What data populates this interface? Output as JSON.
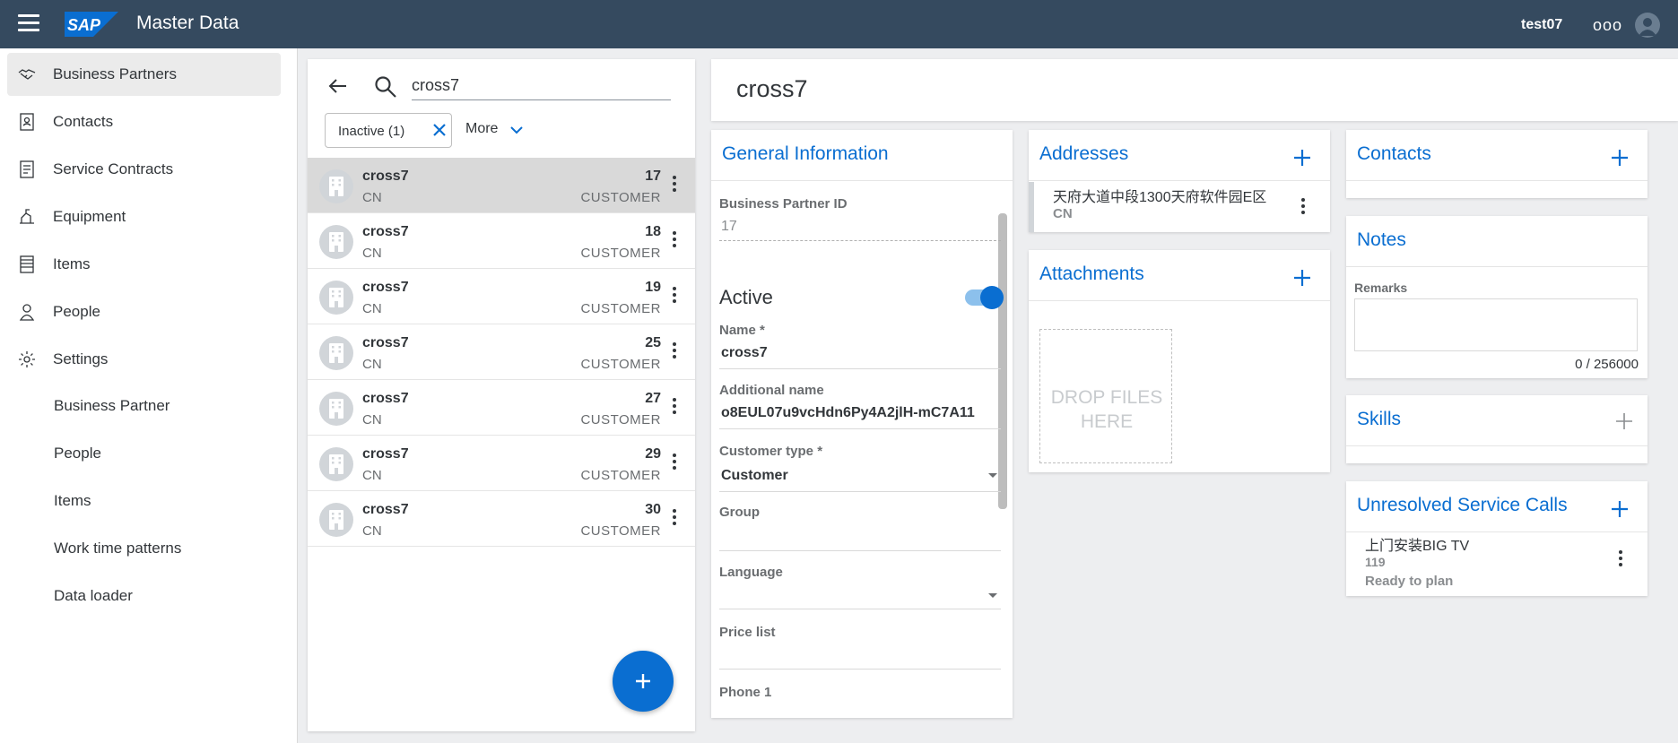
{
  "app": {
    "brand": "SAP",
    "title": "Master Data",
    "user": "test07",
    "more_label": "ooo"
  },
  "sidebar": {
    "items": [
      {
        "label": "Business Partners",
        "icon": "handshake-icon",
        "active": true
      },
      {
        "label": "Contacts",
        "icon": "contact-card-icon"
      },
      {
        "label": "Service Contracts",
        "icon": "contract-icon"
      },
      {
        "label": "Equipment",
        "icon": "equipment-icon"
      },
      {
        "label": "Items",
        "icon": "items-list-icon"
      },
      {
        "label": "People",
        "icon": "person-icon"
      },
      {
        "label": "Settings",
        "icon": "gear-icon"
      }
    ],
    "sub_items": [
      {
        "label": "Business Partner"
      },
      {
        "label": "People"
      },
      {
        "label": "Items"
      },
      {
        "label": "Work time patterns"
      },
      {
        "label": "Data loader"
      }
    ]
  },
  "list": {
    "search_value": "cross7",
    "filter_chip": "Inactive (1)",
    "more_label": "More",
    "rows": [
      {
        "name": "cross7",
        "country": "CN",
        "id": "17",
        "type": "CUSTOMER",
        "selected": true
      },
      {
        "name": "cross7",
        "country": "CN",
        "id": "18",
        "type": "CUSTOMER"
      },
      {
        "name": "cross7",
        "country": "CN",
        "id": "19",
        "type": "CUSTOMER"
      },
      {
        "name": "cross7",
        "country": "CN",
        "id": "25",
        "type": "CUSTOMER"
      },
      {
        "name": "cross7",
        "country": "CN",
        "id": "27",
        "type": "CUSTOMER"
      },
      {
        "name": "cross7",
        "country": "CN",
        "id": "29",
        "type": "CUSTOMER"
      },
      {
        "name": "cross7",
        "country": "CN",
        "id": "30",
        "type": "CUSTOMER"
      }
    ]
  },
  "detail": {
    "title": "cross7",
    "general": {
      "title": "General Information",
      "bp_id_label": "Business Partner ID",
      "bp_id_value": "17",
      "active_label": "Active",
      "active": true,
      "name_label": "Name *",
      "name_value": "cross7",
      "additional_name_label": "Additional name",
      "additional_name_value": "o8EUL07u9vcHdn6Py4A2jlH-mC7A11",
      "customer_type_label": "Customer type *",
      "customer_type_value": "Customer",
      "group_label": "Group",
      "language_label": "Language",
      "price_list_label": "Price list",
      "phone1_label": "Phone 1"
    },
    "addresses": {
      "title": "Addresses",
      "items": [
        {
          "line1": "天府大道中段1300天府软件园E区",
          "line2": "CN"
        }
      ]
    },
    "attachments": {
      "title": "Attachments",
      "dropzone_text": "DROP FILES HERE"
    },
    "contacts": {
      "title": "Contacts"
    },
    "notes": {
      "title": "Notes",
      "remarks_label": "Remarks",
      "remarks_value": "",
      "counter": "0 / 256000"
    },
    "skills": {
      "title": "Skills"
    },
    "service_calls": {
      "title": "Unresolved Service Calls",
      "items": [
        {
          "title": "上门安装BIG TV",
          "id": "119",
          "status": "Ready to plan"
        }
      ]
    }
  },
  "colors": {
    "shell": "#354a5f",
    "accent": "#0a6ed1",
    "background": "#edeef0"
  }
}
